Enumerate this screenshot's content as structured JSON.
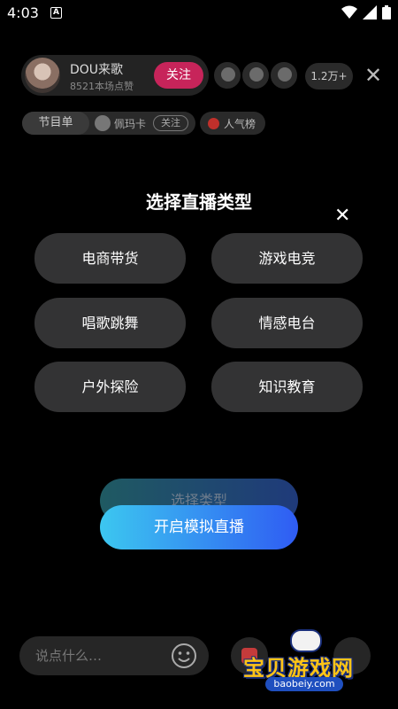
{
  "status_bar": {
    "time": "4:03",
    "notification_badge": "A"
  },
  "host": {
    "name": "DOU来歌",
    "likes": "8521本场点赞",
    "follow_label": "关注"
  },
  "viewers": {
    "count": "1.2万+"
  },
  "program": {
    "label": "节目单",
    "performer": "佩玛卡",
    "follow_label": "关注"
  },
  "ranking": {
    "label": "人气榜"
  },
  "modal": {
    "title": "选择直播类型",
    "types": [
      "电商带货",
      "游戏电竞",
      "唱歌跳舞",
      "情感电台",
      "户外探险",
      "知识教育"
    ]
  },
  "actions": {
    "select_type_label": "选择类型",
    "start_label": "开启模拟直播"
  },
  "comment": {
    "placeholder": "说点什么…"
  },
  "watermark": {
    "brand": "宝贝游戏网",
    "url": "baobeiy.com"
  },
  "colors": {
    "follow": "#c7245a",
    "start_gradient_from": "#3cc7f0",
    "start_gradient_to": "#2f5cf3",
    "button_bg": "#333334"
  }
}
